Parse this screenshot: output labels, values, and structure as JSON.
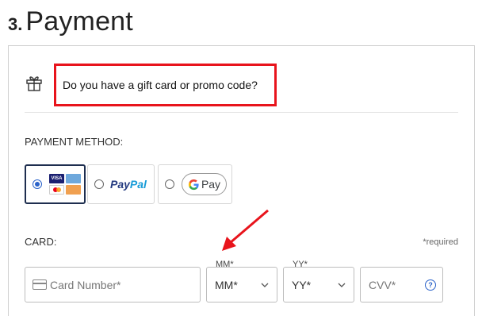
{
  "heading": {
    "number": "3.",
    "title": "Payment"
  },
  "promo": {
    "text": "Do you have a gift card or promo code?",
    "icon": "gift-icon"
  },
  "payment_method": {
    "label": "PAYMENT METHOD:",
    "options": [
      {
        "id": "card",
        "selected": true,
        "icons": [
          "visa",
          "amex",
          "mastercard",
          "discover"
        ]
      },
      {
        "id": "paypal",
        "selected": false,
        "logo_part1": "Pay",
        "logo_part2": "Pal"
      },
      {
        "id": "gpay",
        "selected": false,
        "logo_g": "G",
        "logo_text": "Pay"
      }
    ]
  },
  "card": {
    "label": "CARD:",
    "required_note": "*required",
    "number_placeholder": "Card Number*",
    "month": {
      "float_label": "MM*",
      "value": "MM*"
    },
    "year": {
      "float_label": "YY*",
      "value": "YY*"
    },
    "cvv_placeholder": "CVV*",
    "help_icon": "?"
  },
  "colors": {
    "highlight_red": "#e8141c",
    "accent_blue": "#2a62c9",
    "selected_border": "#1e2e4f"
  }
}
